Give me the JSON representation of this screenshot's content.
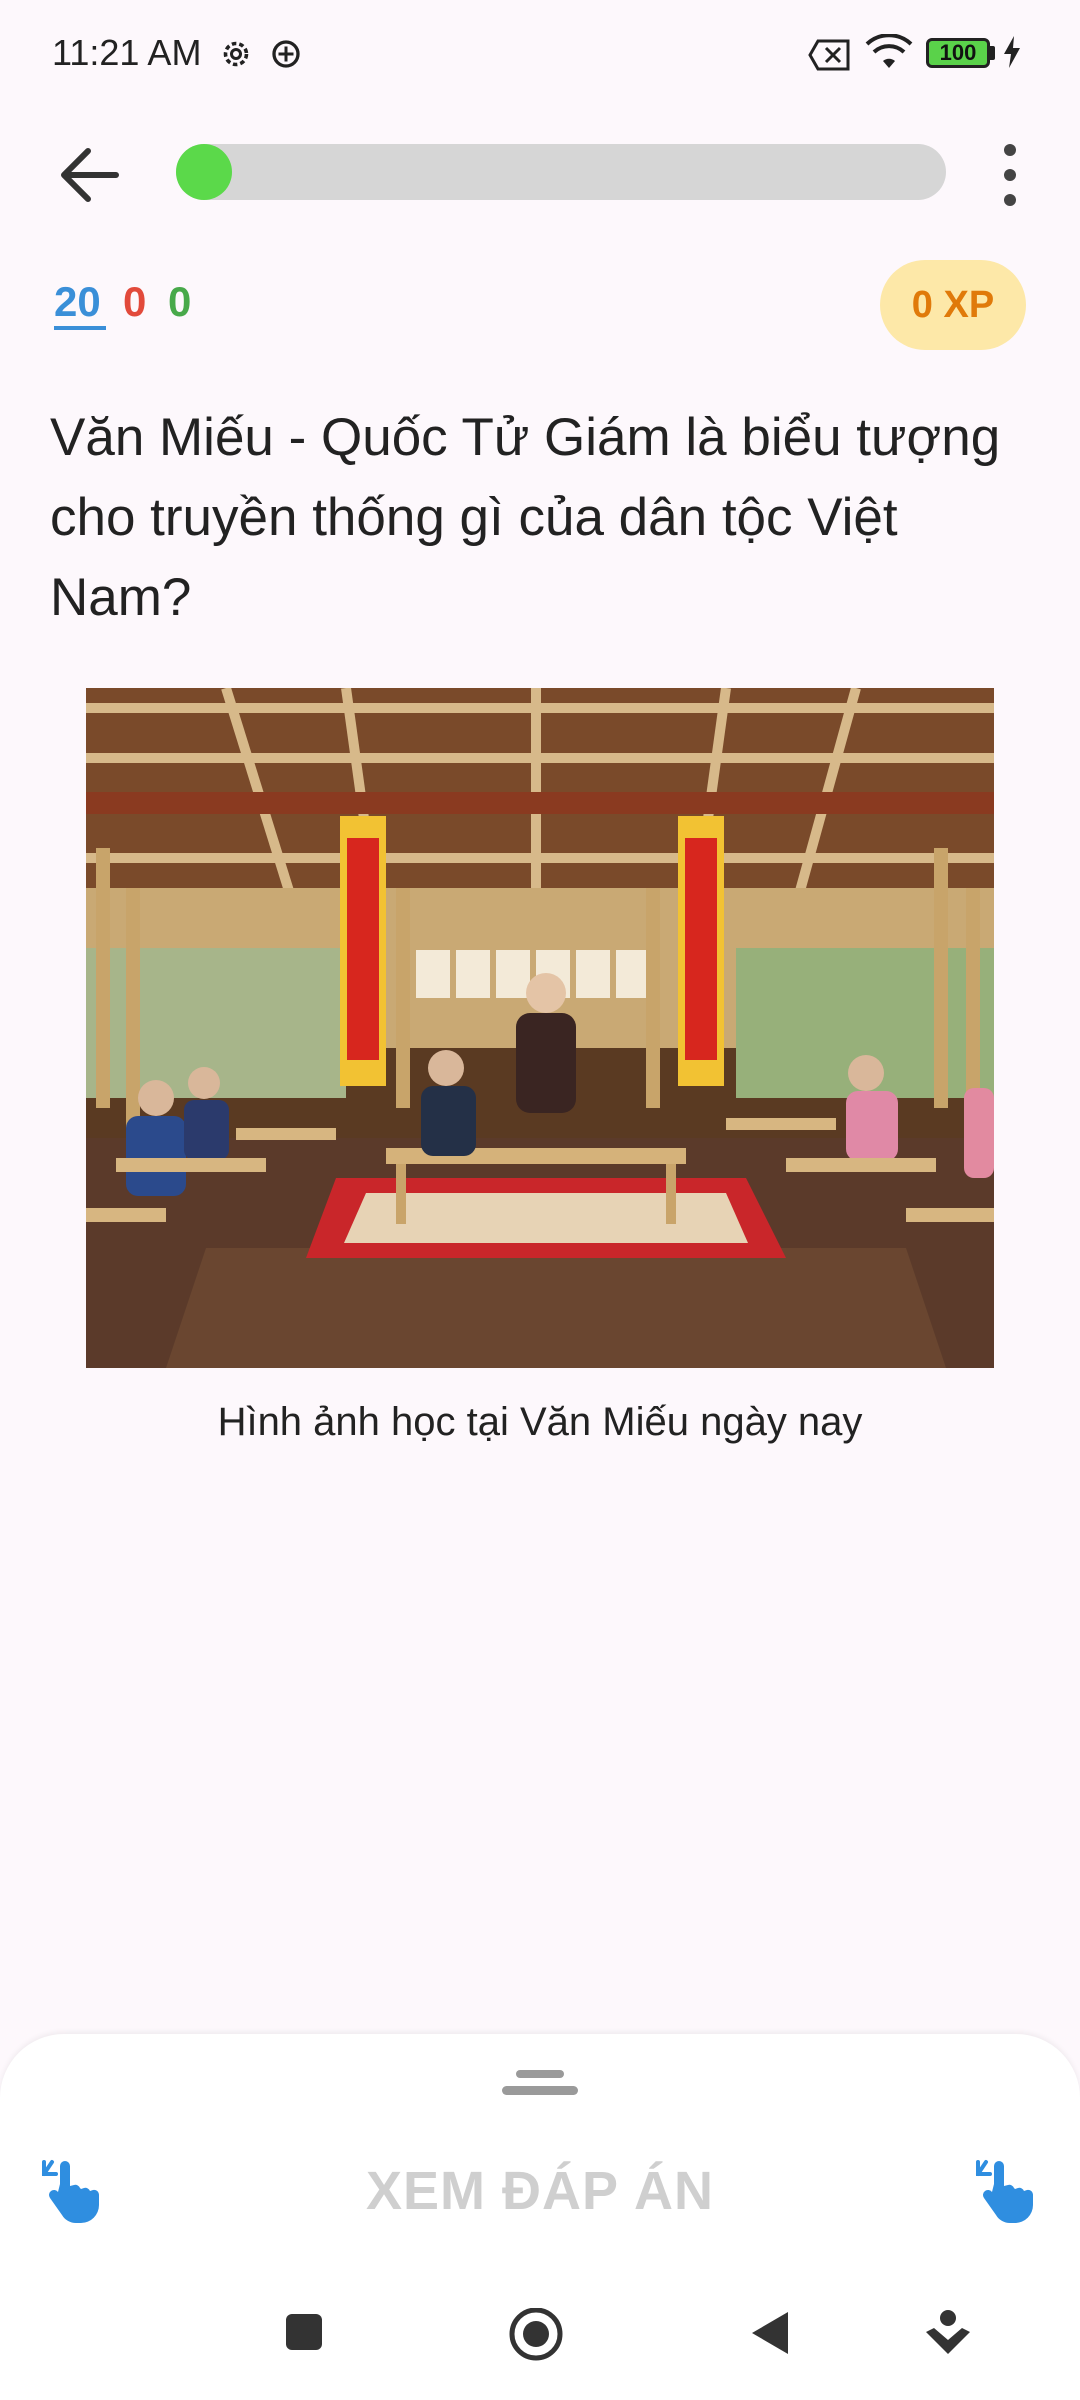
{
  "status_bar": {
    "time": "11:21 AM",
    "battery": "100"
  },
  "score": {
    "total": "20",
    "wrong": "0",
    "correct": "0",
    "xp": "0 XP"
  },
  "progress": {
    "fraction": 0.0
  },
  "question": {
    "text": "Văn Miếu - Quốc Tử Giám là biểu tượng cho truyền thống gì của dân tộc Việt Nam?"
  },
  "image": {
    "caption": "Hình ảnh học tại Văn Miếu ngày nay"
  },
  "sheet": {
    "reveal_label": "XEM ĐÁP ÁN"
  },
  "colors": {
    "accent_blue": "#3a8fd8",
    "wrong_red": "#e24a3b",
    "correct_green": "#48a94a",
    "xp_orange": "#e07a0a",
    "progress_green": "#5bd94a"
  }
}
